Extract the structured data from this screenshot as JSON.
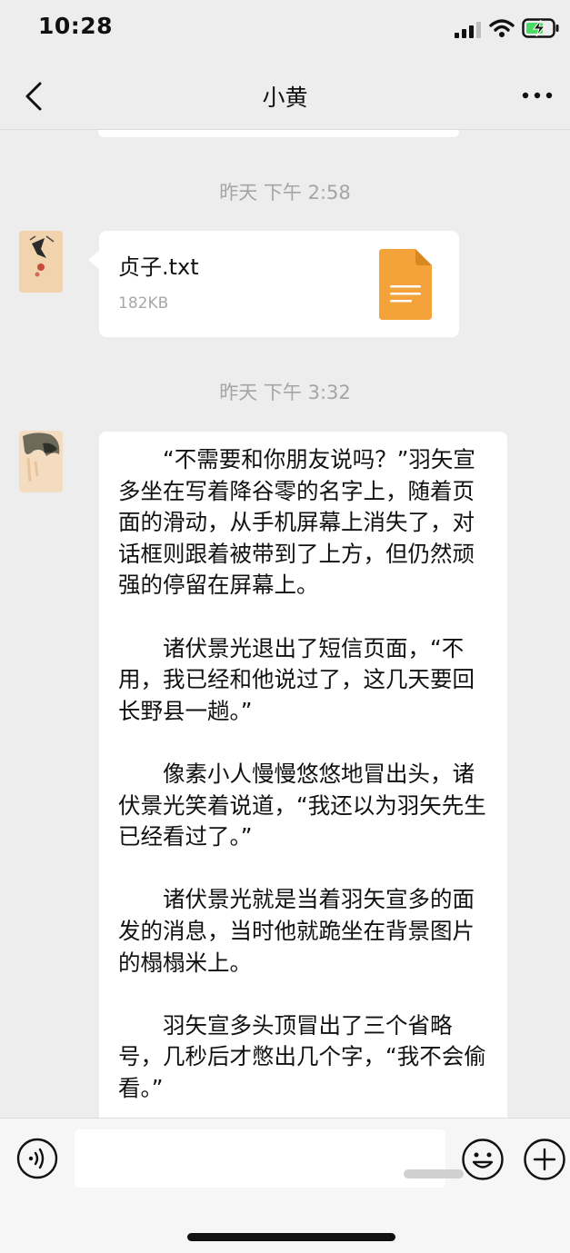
{
  "status_bar": {
    "time": "10:28"
  },
  "nav": {
    "title": "小黄"
  },
  "messages": {
    "timestamp_1": "昨天 下午 2:58",
    "file": {
      "name": "贞子.txt",
      "size": "182KB"
    },
    "timestamp_2": "昨天 下午 3:32",
    "text_paragraphs": [
      "“不需要和你朋友说吗？”羽矢宣多坐在写着降谷零的名字上，随着页面的滑动，从手机屏幕上消失了，对话框则跟着被带到了上方，但仍然顽强的停留在屏幕上。",
      "诸伏景光退出了短信页面，“不用，我已经和他说过了，这几天要回长野县一趟。”",
      "像素小人慢慢悠悠地冒出头，诸伏景光笑着说道，“我还以为羽矢先生已经看过了。”",
      "诸伏景光就是当着羽矢宣多的面发的消息，当时他就跪坐在背景图片的榻榻米上。",
      "羽矢宣多头顶冒出了三个省略号，几秒后才憋出几个字，“我不会偷看。”"
    ]
  },
  "input_bar": {
    "text_value": "",
    "placeholder": ""
  },
  "icons": {
    "back": "chevron-left-icon",
    "more": "more-dots-icon",
    "voice": "voice-icon",
    "emoji": "emoji-icon",
    "plus": "plus-icon",
    "file": "document-file-icon"
  },
  "colors": {
    "background": "#ededed",
    "bubble": "#ffffff",
    "file_icon": "#f4a23a",
    "timestamp": "#a5a5a5"
  }
}
